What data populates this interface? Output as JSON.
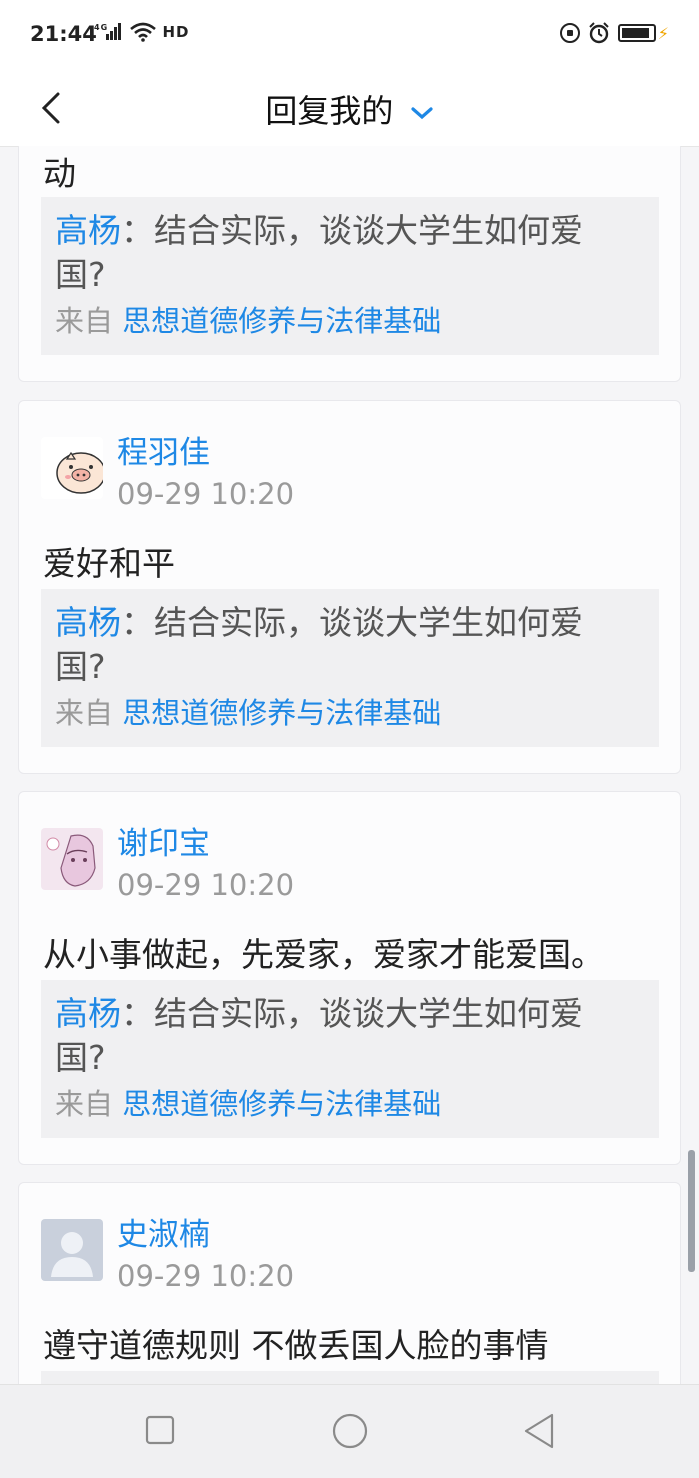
{
  "status_bar": {
    "time": "21:44",
    "network": "4G",
    "hd": "HD",
    "icons": [
      "signal-icon",
      "wifi-icon",
      "hd-icon",
      "lock-rotation-icon",
      "alarm-icon",
      "battery-icon",
      "charging-icon"
    ]
  },
  "header": {
    "title": "回复我的",
    "back_icon": "chevron-left-icon",
    "dropdown_icon": "chevron-down-icon",
    "accent_color": "#1e88e5"
  },
  "items": [
    {
      "user": "",
      "time": "",
      "reply": "动",
      "quote_author": "高杨",
      "quote_line1": "：结合实际，谈谈大学生如何爱",
      "quote_line2": "国?",
      "source_prefix": "来自",
      "source_course": "思想道德修养与法律基础"
    },
    {
      "user": "程羽佳",
      "time": "09-29 10:20",
      "avatar": "pig-avatar",
      "reply": "爱好和平",
      "quote_author": "高杨",
      "quote_line1": "：结合实际，谈谈大学生如何爱",
      "quote_line2": "国?",
      "source_prefix": "来自",
      "source_course": "思想道德修养与法律基础"
    },
    {
      "user": "谢印宝",
      "time": "09-29 10:20",
      "avatar": "anime-avatar",
      "reply": "从小事做起，先爱家，爱家才能爱国。",
      "quote_author": "高杨",
      "quote_line1": "：结合实际，谈谈大学生如何爱",
      "quote_line2": "国?",
      "source_prefix": "来自",
      "source_course": "思想道德修养与法律基础"
    },
    {
      "user": "史淑楠",
      "time": "09-29 10:20",
      "avatar": "default-avatar",
      "reply": "遵守道德规则 不做丢国人脸的事情"
    }
  ],
  "nav_bar": {
    "buttons": [
      "recents-square-icon",
      "home-circle-icon",
      "back-triangle-icon"
    ]
  }
}
